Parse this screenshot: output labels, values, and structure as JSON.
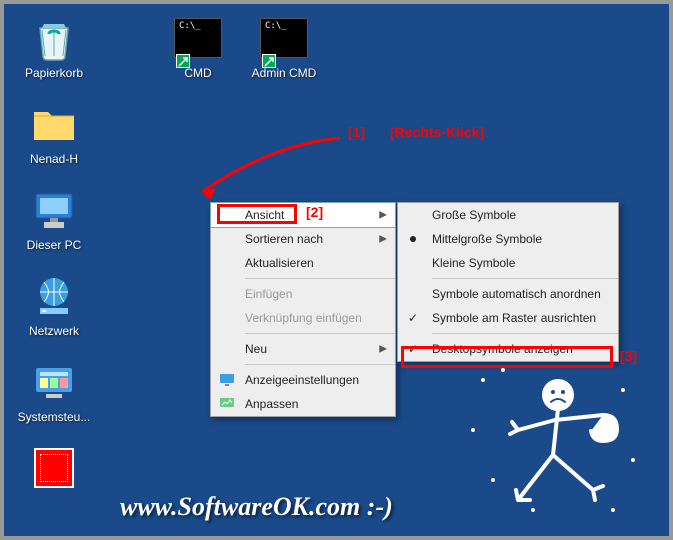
{
  "desktop": {
    "icons": [
      {
        "label": "Papierkorb",
        "kind": "recycle"
      },
      {
        "label": "Nenad-H",
        "kind": "userfolder"
      },
      {
        "label": "Dieser PC",
        "kind": "pc"
      },
      {
        "label": "Netzwerk",
        "kind": "network"
      },
      {
        "label": "Systemsteu...",
        "kind": "control"
      },
      {
        "label": "",
        "kind": "redapp"
      },
      {
        "label": "CMD",
        "kind": "cmd"
      },
      {
        "label": "Admin CMD",
        "kind": "cmd"
      }
    ]
  },
  "context_menu": {
    "items": [
      {
        "label": "Ansicht",
        "submenu": true,
        "hover": true
      },
      {
        "label": "Sortieren nach",
        "submenu": true
      },
      {
        "label": "Aktualisieren"
      },
      {
        "sep": true
      },
      {
        "label": "Einfügen",
        "disabled": true
      },
      {
        "label": "Verknüpfung einfügen",
        "disabled": true
      },
      {
        "sep": true
      },
      {
        "label": "Neu",
        "submenu": true
      },
      {
        "sep": true
      },
      {
        "label": "Anzeigeeinstellungen",
        "icon": "display"
      },
      {
        "label": "Anpassen",
        "icon": "personalize"
      }
    ]
  },
  "submenu": {
    "items": [
      {
        "label": "Große Symbole"
      },
      {
        "label": "Mittelgroße Symbole",
        "bullet": true
      },
      {
        "label": "Kleine Symbole"
      },
      {
        "sep": true
      },
      {
        "label": "Symbole automatisch anordnen"
      },
      {
        "label": "Symbole am Raster ausrichten",
        "check": true
      },
      {
        "sep": true
      },
      {
        "label": "Desktopsymbole anzeigen",
        "check": true
      }
    ]
  },
  "annotations": {
    "a1": "[1]",
    "a1b": "[Rechts-Klick]",
    "a2": "[2]",
    "a3": "[3]"
  },
  "watermark": "www.SoftwareOK.com :-)"
}
